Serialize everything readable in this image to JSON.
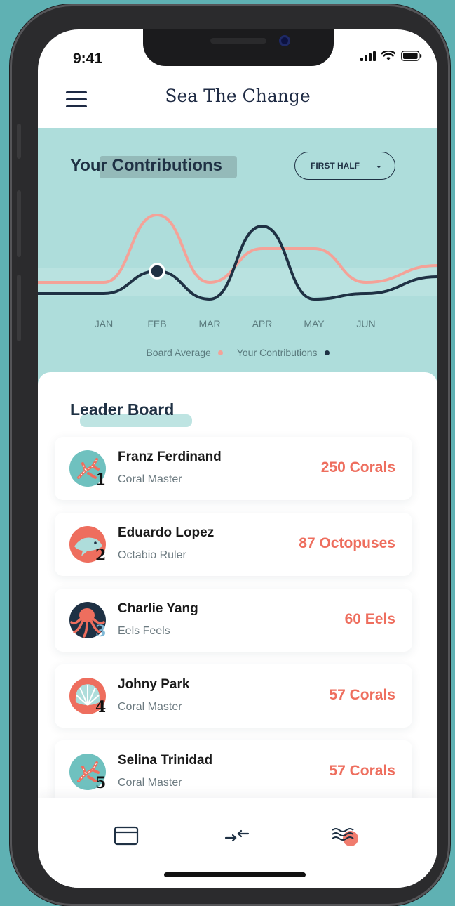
{
  "status": {
    "time": "9:41"
  },
  "header": {
    "app_title": "Sea The Change"
  },
  "contributions": {
    "title": "Your Contributions",
    "period": "FIRST HALF"
  },
  "chart_data": {
    "type": "line",
    "categories": [
      "JAN",
      "FEB",
      "MAR",
      "APR",
      "MAY",
      "JUN"
    ],
    "grid": false,
    "legend": "bottom",
    "series": [
      {
        "name": "Board Average",
        "color": "#f4a298",
        "values": [
          2.5,
          8.5,
          2.5,
          5.5,
          5.5,
          2.5
        ]
      },
      {
        "name": "Your Contributions",
        "color": "#1f3144",
        "values": [
          1.5,
          3.5,
          1.0,
          7.5,
          1.0,
          1.5
        ]
      }
    ],
    "highlight_point": {
      "series": "Your Contributions",
      "category": "FEB"
    }
  },
  "legend": {
    "board_average": "Board Average",
    "your_contributions": "Your Contributions"
  },
  "leaderboard": {
    "title": "Leader Board",
    "rows": [
      {
        "rank": "1",
        "name": "Franz Ferdinand",
        "title": "Coral Master",
        "score": "250 Corals",
        "avatar_icon": "coral-icon"
      },
      {
        "rank": "2",
        "name": "Eduardo Lopez",
        "title": "Octabio Ruler",
        "score": "87 Octopuses",
        "avatar_icon": "shark-icon"
      },
      {
        "rank": "3",
        "name": "Charlie Yang",
        "title": "Eels Feels",
        "score": "60 Eels",
        "avatar_icon": "octopus-icon"
      },
      {
        "rank": "4",
        "name": "Johny Park",
        "title": "Coral Master",
        "score": "57 Corals",
        "avatar_icon": "shell-icon"
      },
      {
        "rank": "5",
        "name": "Selina Trinidad",
        "title": "Coral Master",
        "score": "57 Corals",
        "avatar_icon": "coral-icon"
      }
    ]
  },
  "tabbar": {
    "tabs": [
      {
        "icon": "card-icon"
      },
      {
        "icon": "transfer-icon"
      },
      {
        "icon": "waves-icon",
        "active": true
      }
    ]
  },
  "colors": {
    "teal": "#aedddb",
    "navy": "#1f3144",
    "coral": "#ee6e5e",
    "salmon": "#f4a298"
  }
}
